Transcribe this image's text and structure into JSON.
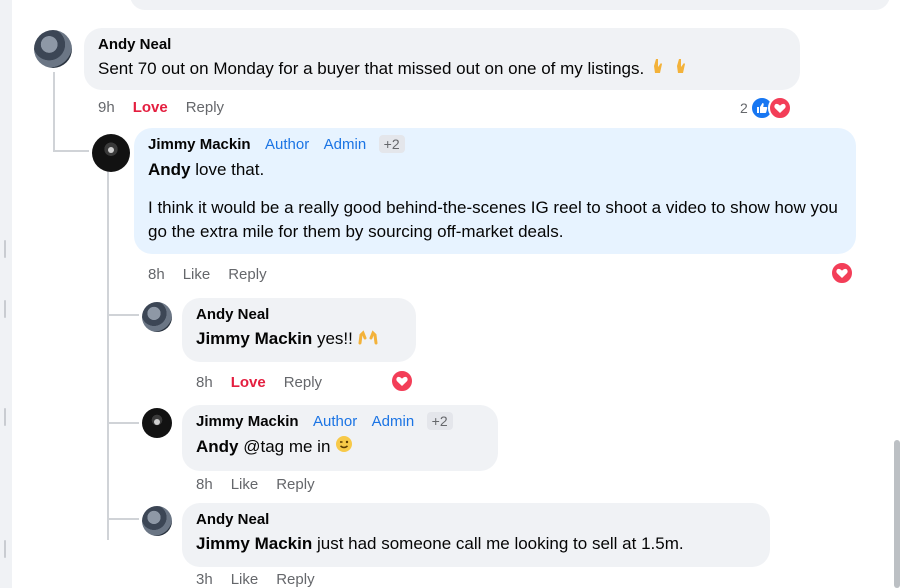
{
  "comments": [
    {
      "author": "Andy Neal",
      "text": "Sent 70 out on Monday for a buyer that missed out on one of my listings.",
      "time": "9h",
      "love": "Love",
      "reply": "Reply",
      "reaction_count": "2",
      "reactions": [
        "like",
        "heart"
      ]
    },
    {
      "author": "Jimmy Mackin",
      "badges": [
        "Author",
        "Admin",
        "+2"
      ],
      "mention": "Andy",
      "text": " love that.",
      "text2": "I think it would be a really good behind-the-scenes IG reel to shoot a video to show how you go the extra mile for them by sourcing off-market deals.",
      "time": "8h",
      "like": "Like",
      "reply": "Reply",
      "reactions": [
        "heart"
      ]
    },
    {
      "author": "Andy Neal",
      "mention": "Jimmy Mackin",
      "text": " yes!!",
      "time": "8h",
      "love": "Love",
      "reply": "Reply",
      "reactions": [
        "heart"
      ]
    },
    {
      "author": "Jimmy Mackin",
      "badges": [
        "Author",
        "Admin",
        "+2"
      ],
      "mention": "Andy",
      "text": " @tag me in",
      "time": "8h",
      "like": "Like",
      "reply": "Reply"
    },
    {
      "author": "Andy Neal",
      "mention": "Jimmy Mackin",
      "text": " just had someone call me looking to sell at 1.5m.",
      "time": "3h",
      "like": "Like",
      "reply": "Reply"
    }
  ],
  "colors": {
    "bubble": "#f0f2f5",
    "author_bubble": "#e7f3ff",
    "love": "#e41e3f",
    "badge": "#1b74e4"
  },
  "icons": [
    "crossed-fingers-emoji",
    "raising-hands-emoji",
    "winking-face-emoji",
    "like-reaction-icon",
    "heart-reaction-icon"
  ]
}
